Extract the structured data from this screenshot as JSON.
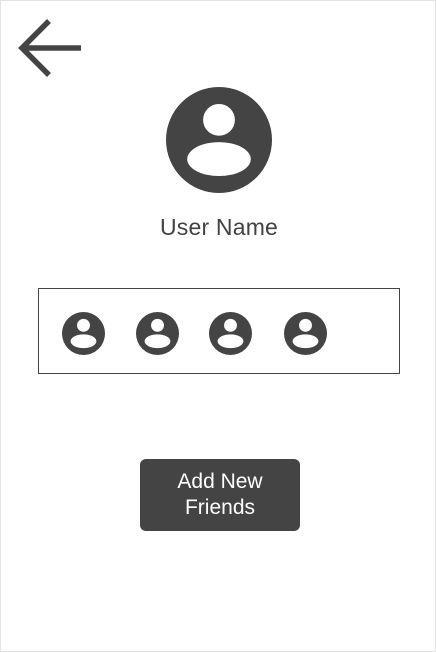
{
  "profile": {
    "user_name": "User Name",
    "avatar_icon": "user-circle-icon"
  },
  "navigation": {
    "back_icon": "arrow-left-icon"
  },
  "friends": {
    "items": [
      {
        "icon": "user-circle-icon"
      },
      {
        "icon": "user-circle-icon"
      },
      {
        "icon": "user-circle-icon"
      },
      {
        "icon": "user-circle-icon"
      }
    ]
  },
  "actions": {
    "add_friends_label": "Add New Friends"
  },
  "colors": {
    "primary_dark": "#444444",
    "text": "#424242",
    "background": "#ffffff"
  }
}
